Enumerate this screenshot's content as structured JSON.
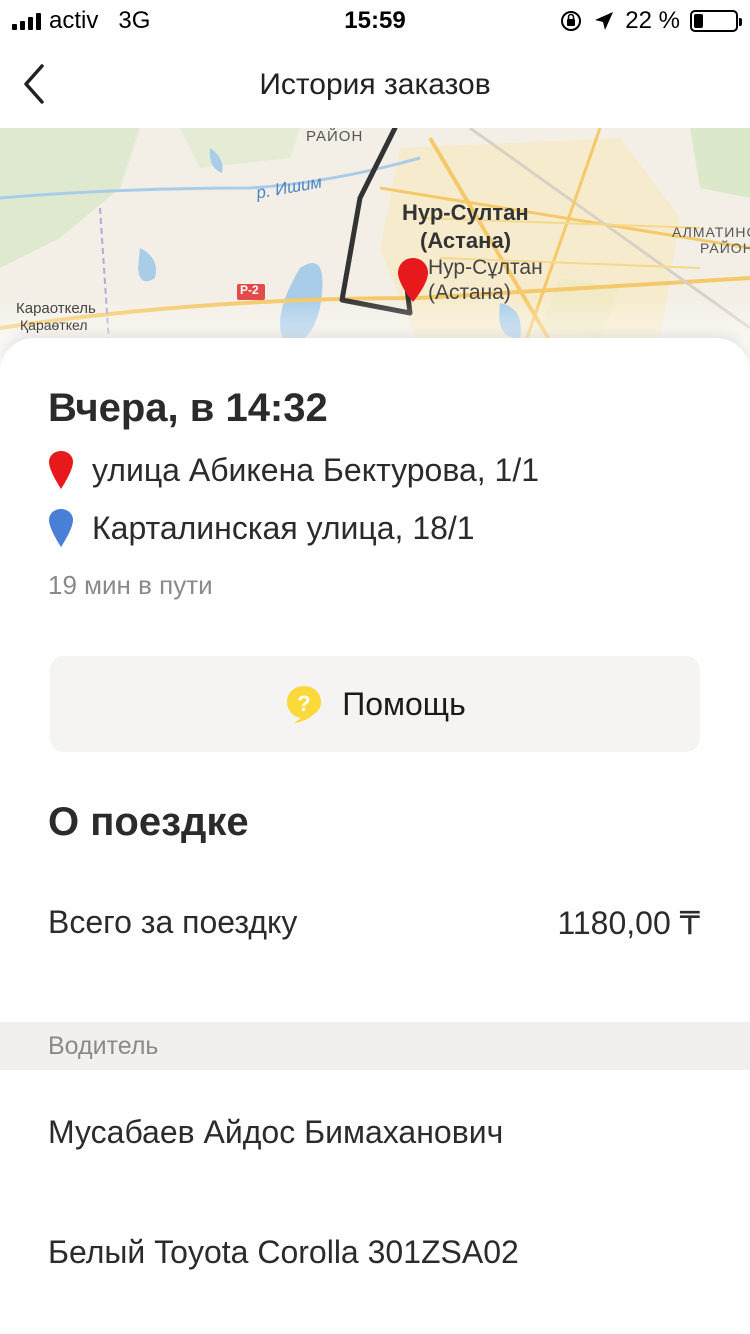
{
  "status_bar": {
    "carrier": "activ",
    "network": "3G",
    "time": "15:59",
    "battery": "22 %",
    "battery_level": 0.22
  },
  "nav": {
    "title": "История заказов",
    "back_icon": "chevron-left-icon"
  },
  "map": {
    "labels": {
      "city_main": "Нур-Султан",
      "city_main_alt": "(Астана)",
      "city_secondary": "Нур-Сұлтан",
      "city_secondary_alt": "(Астана)",
      "district_top": "РАЙОН",
      "district_right_1": "АЛМАТИНСК",
      "district_right_2": "РАЙОН",
      "river": "р. Ишим",
      "road": "Р-2",
      "village_1": "Караоткель",
      "village_2": "Қараөткел"
    },
    "route_color": "#333333",
    "pin_color": "#e8191c"
  },
  "order": {
    "time": "Вчера, в 14:32",
    "from": "улица Абикена Бектурова, 1/1",
    "to": "Карталинская улица, 18/1",
    "duration": "19 мин в пути",
    "from_pin_color": "#e8191c",
    "to_pin_color": "#4a7fd6"
  },
  "help": {
    "label": "Помощь",
    "icon": "question-bubble-icon",
    "icon_color": "#fcd93a"
  },
  "trip": {
    "section_title": "О поездке",
    "total_label": "Всего за поездку",
    "total_value": "1180,00 ₸"
  },
  "driver": {
    "section_header": "Водитель",
    "name": "Мусабаев Айдос Бимаханович",
    "car": "Белый Toyota Corolla 301ZSA02"
  }
}
